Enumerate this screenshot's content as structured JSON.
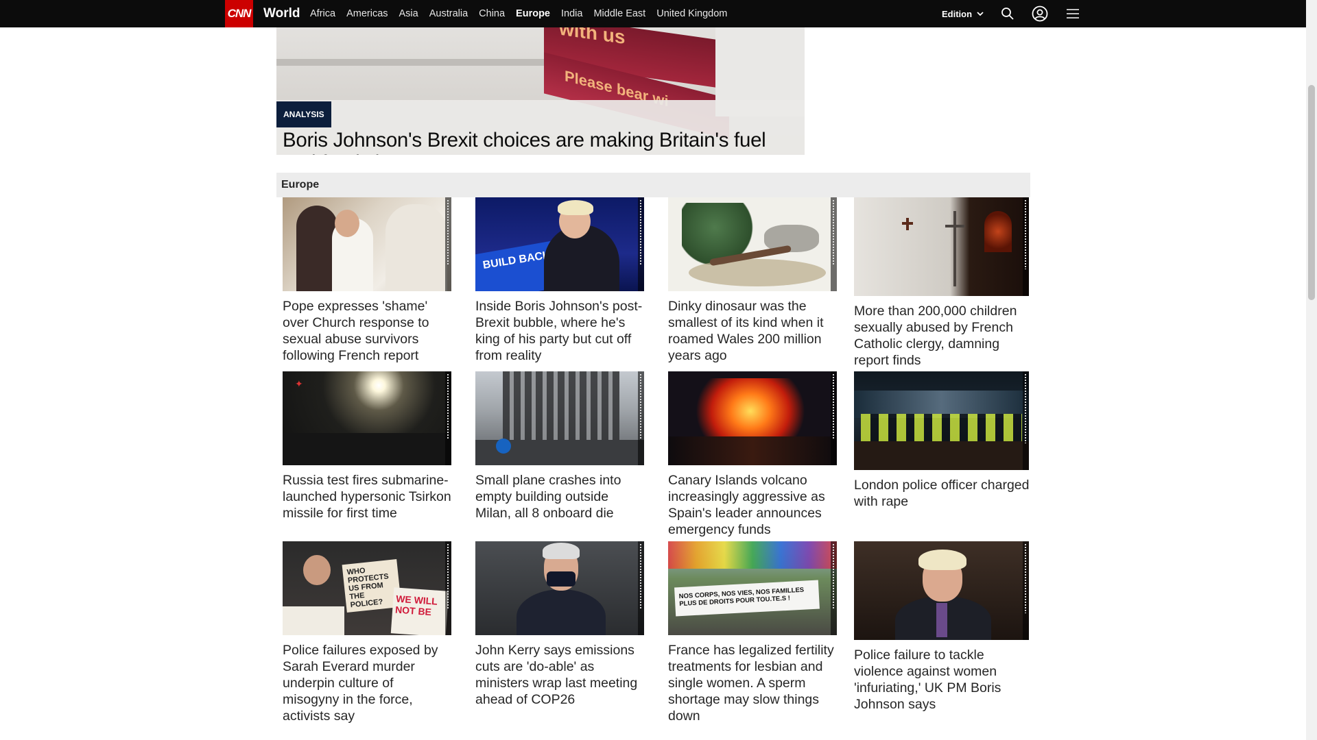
{
  "nav": {
    "logo": "CNN",
    "section": "World",
    "links": [
      "Africa",
      "Americas",
      "Asia",
      "Australia",
      "China",
      "Europe",
      "India",
      "Middle East",
      "United Kingdom"
    ],
    "active_link": "Europe",
    "edition_label": "Edition",
    "icons": [
      "search-icon",
      "user-account-icon",
      "hamburger-menu-icon"
    ]
  },
  "hero": {
    "badge": "ANALYSIS",
    "headline": "Boris Johnson's Brexit choices are making Britain's fuel and food shortages worse",
    "image_text_1": "with us",
    "image_text_2": "Please bear wi"
  },
  "zone": {
    "title": "Europe",
    "cards": [
      {
        "headline": "Pope expresses 'shame' over Church response to sexual abuse survivors following French report"
      },
      {
        "headline": "Inside Boris Johnson's post-Brexit bubble, where he's king of his party but cut off from reality",
        "image_text": "BUILD BACK BETTER"
      },
      {
        "headline": "Dinky dinosaur was the smallest of its kind when it roamed Wales 200 million years ago"
      },
      {
        "headline": "More than 200,000 children sexually abused by French Catholic clergy, damning report finds"
      },
      {
        "headline": "Russia test fires submarine-launched hypersonic Tsirkon missile for first time"
      },
      {
        "headline": "Small plane crashes into empty building outside Milan, all 8 onboard die"
      },
      {
        "headline": "Canary Islands volcano increasingly aggressive as Spain's leader announces emergency funds"
      },
      {
        "headline": "London police officer charged with rape"
      },
      {
        "headline": "Police failures exposed by Sarah Everard murder underpin culture of misogyny in the force, activists say",
        "image_text_1": "WHO PROTECTS US FROM THE POLICE?",
        "image_text_2": "WE WILL NOT BE"
      },
      {
        "headline": "John Kerry says emissions cuts are 'do-able' as ministers wrap last meeting ahead of COP26"
      },
      {
        "headline": "France has legalized fertility treatments for lesbian and single women. A sperm shortage may slow things down",
        "image_text": "NOS CORPS, NOS VIES, NOS FAMILLES PLUS DE DROITS POUR TOU.TE.S !"
      },
      {
        "headline": "Police failure to tackle violence against women 'infuriating,' UK PM Boris Johnson says"
      }
    ]
  },
  "colors": {
    "nav_bg": "#0c0c0c",
    "brand_red": "#cc0000",
    "badge_bg": "#0c1e3c",
    "zone_header_bg": "#ececec"
  }
}
